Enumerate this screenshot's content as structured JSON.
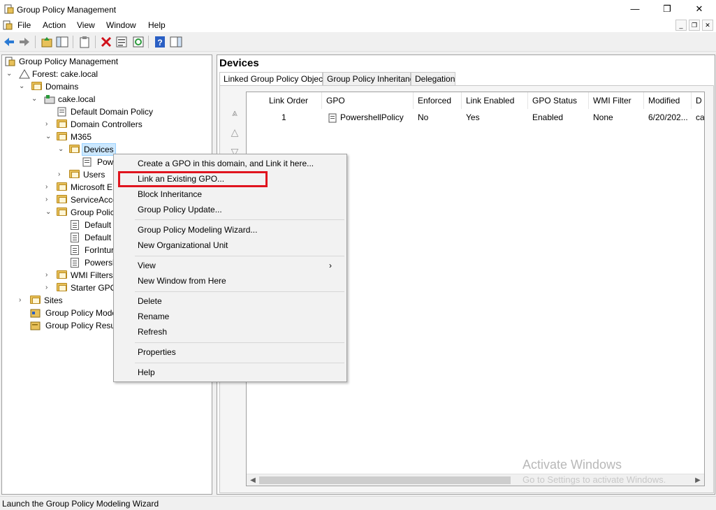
{
  "window": {
    "title": "Group Policy Management",
    "minimize": "—",
    "maximize": "❐",
    "close": "✕"
  },
  "menubar": [
    "File",
    "Action",
    "View",
    "Window",
    "Help"
  ],
  "tree": {
    "root": "Group Policy Management",
    "forest": "Forest: cake.local",
    "domains": "Domains",
    "domain": "cake.local",
    "items": [
      "Default Domain Policy",
      "Domain Controllers",
      "M365",
      "Devices",
      "Pow",
      "Users",
      "Microsoft E",
      "ServiceAcco",
      "Group Polic",
      "Default",
      "Default",
      "ForIntur",
      "Powersh",
      "WMI Filters",
      "Starter GPO"
    ],
    "sites": "Sites",
    "modeling": "Group Policy Mode",
    "results": "Group Policy Resul"
  },
  "right": {
    "title": "Devices",
    "tabs": [
      "Linked Group Policy Objects",
      "Group Policy Inheritance",
      "Delegation"
    ],
    "columns": [
      "Link Order",
      "GPO",
      "Enforced",
      "Link Enabled",
      "GPO Status",
      "WMI Filter",
      "Modified",
      "D"
    ],
    "rows": [
      [
        "1",
        "PowershellPolicy",
        "No",
        "Yes",
        "Enabled",
        "None",
        "6/20/202...",
        "ca"
      ]
    ]
  },
  "context_menu": {
    "items": [
      "Create a GPO in this domain, and Link it here...",
      "Link an Existing GPO...",
      "Block Inheritance",
      "Group Policy Update...",
      "Group Policy Modeling Wizard...",
      "New Organizational Unit",
      "View",
      "New Window from Here",
      "Delete",
      "Rename",
      "Refresh",
      "Properties",
      "Help"
    ],
    "highlighted": "Link an Existing GPO..."
  },
  "watermark": {
    "line1": "Activate Windows",
    "line2": "Go to Settings to activate Windows."
  },
  "status": "Launch the Group Policy Modeling Wizard",
  "colors": {
    "highlight_border": "#e0141e",
    "selection": "#cce8ff",
    "folder": "#e8c15a"
  }
}
